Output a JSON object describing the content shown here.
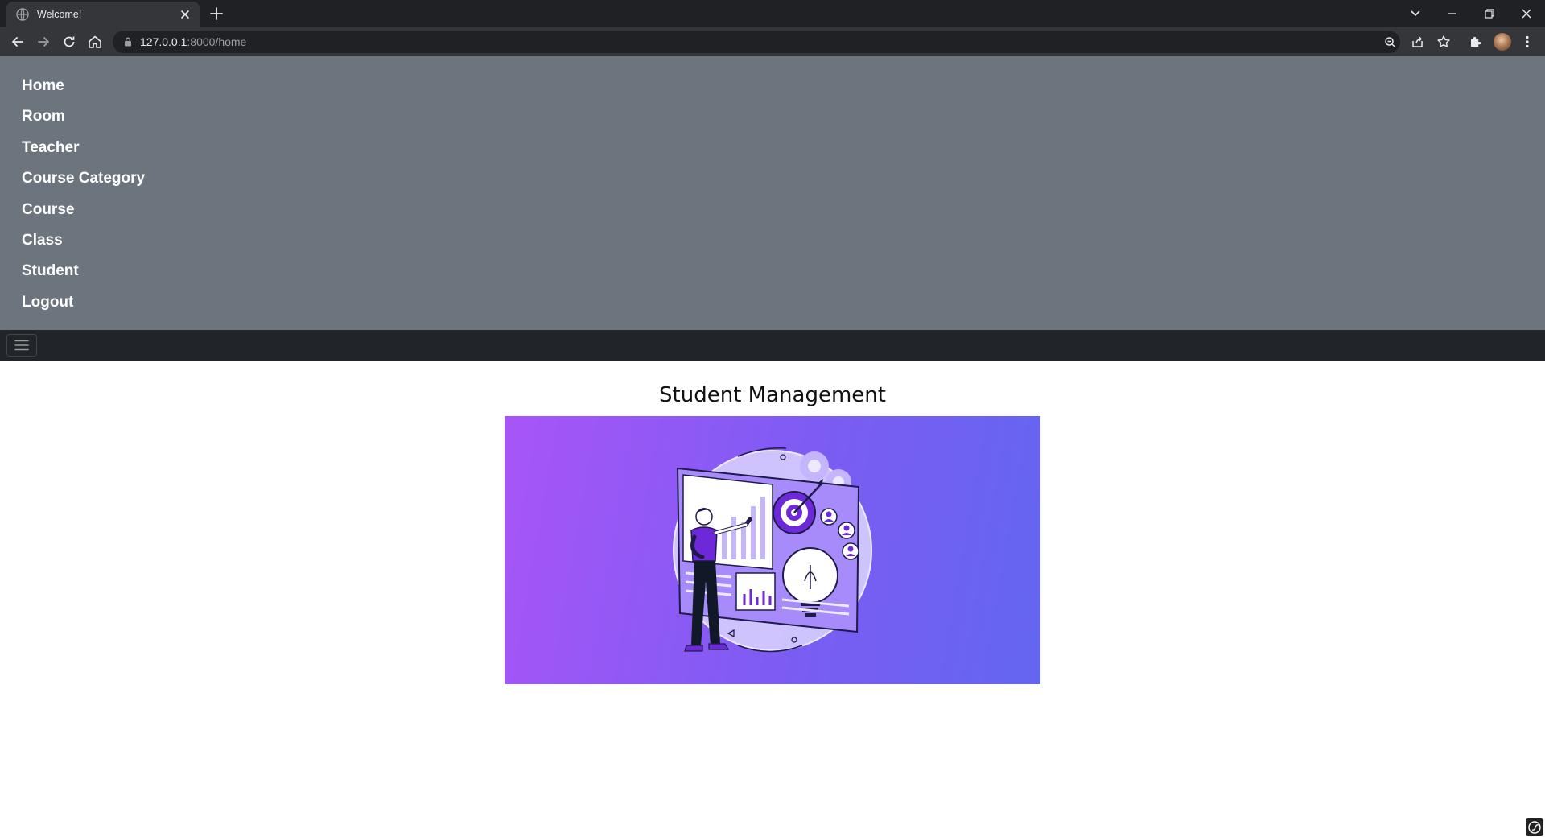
{
  "browser": {
    "tab": {
      "title": "Welcome!"
    },
    "address_bar": {
      "host": "127.0.0.1",
      "rest": ":8000/home"
    }
  },
  "menu": {
    "items": [
      {
        "label": "Home"
      },
      {
        "label": "Room"
      },
      {
        "label": "Teacher"
      },
      {
        "label": "Course Category"
      },
      {
        "label": "Course"
      },
      {
        "label": "Class"
      },
      {
        "label": "Student"
      },
      {
        "label": "Logout"
      }
    ]
  },
  "main": {
    "title": "Student Management"
  },
  "colors": {
    "menu_panel": "#6c757d",
    "navbar": "#212529",
    "hero_gradient_start": "#a855f7",
    "hero_gradient_end": "#6366f1"
  },
  "icons": {
    "tab": [
      "globe-icon",
      "close-icon",
      "plus-icon"
    ],
    "window": [
      "chevron-down-icon",
      "minimize-icon",
      "restore-icon",
      "close-icon"
    ],
    "toolbar": [
      "back-arrow-icon",
      "forward-arrow-icon",
      "reload-icon",
      "home-icon",
      "lock-icon",
      "zoom-icon",
      "share-icon",
      "star-icon",
      "puzzle-icon",
      "kebab-menu-icon"
    ],
    "page": [
      "hamburger-icon"
    ]
  }
}
